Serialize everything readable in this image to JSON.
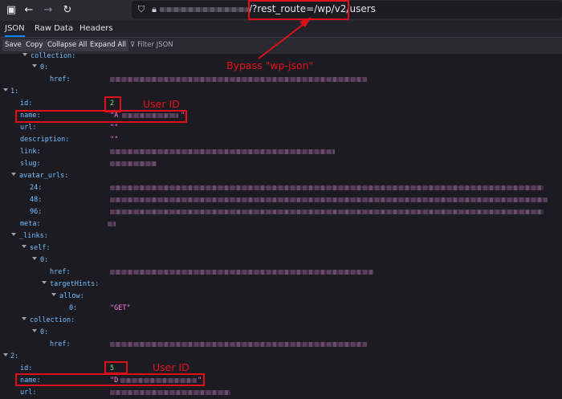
{
  "browser": {
    "back_icon": "arrow-left-icon",
    "forward_icon": "arrow-right-icon",
    "reload_icon": "reload-icon",
    "url_visible": "/?rest_route=/wp/v2/users"
  },
  "viewer": {
    "tabs": [
      {
        "label": "JSON",
        "active": true
      },
      {
        "label": "Raw Data"
      },
      {
        "label": "Headers"
      }
    ],
    "toolbar": {
      "save": "Save",
      "copy": "Copy",
      "collapse_all": "Collapse All",
      "expand_all": "Expand All",
      "filter_placeholder": "Filter JSON"
    }
  },
  "json": {
    "k_collection": "collection:",
    "k_0": "0:",
    "k_href": "href:",
    "k_1": "1:",
    "k_id": "id:",
    "k_name": "name:",
    "k_url": "url:",
    "k_description": "description:",
    "k_link": "link:",
    "k_slug": "slug:",
    "k_avatar": "avatar_urls:",
    "k_24": "24:",
    "k_48": "48:",
    "k_96": "96:",
    "k_meta": "meta:",
    "k_links": "_links:",
    "k_self": "self:",
    "k_targethints": "targetHints:",
    "k_allow": "allow:",
    "k_2": "2:",
    "user1_id": "2",
    "user1_name_prefix": "\"A",
    "quote_close": "\"",
    "empty_string": "\"\"",
    "allow_value": "\"GET\"",
    "user2_id": "5",
    "user2_name_prefix": "\"D"
  },
  "annotations": {
    "bypass": "Bypass \"wp-json\"",
    "user_id_1": "User ID",
    "user_id_2": "User ID",
    "color": "#e0101a"
  }
}
